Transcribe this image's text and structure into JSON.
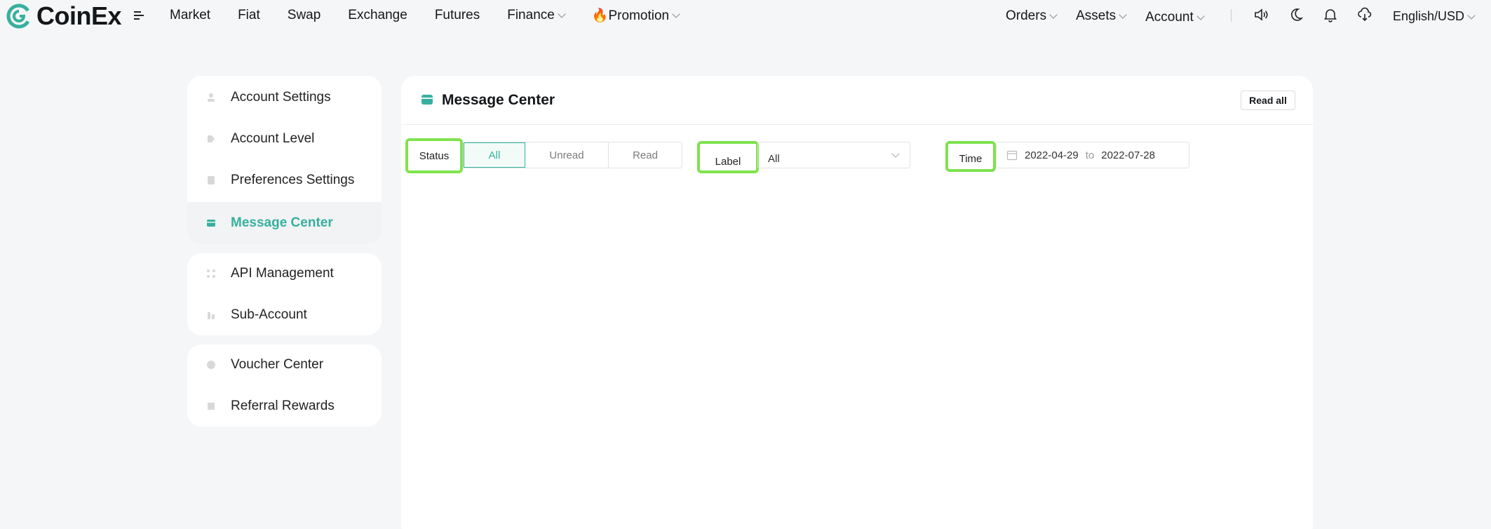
{
  "brand": {
    "name": "CoinEx",
    "accent": "#36b09e",
    "highlight": "#7ee34d"
  },
  "nav": {
    "left": [
      {
        "label": "Market",
        "dropdown": false
      },
      {
        "label": "Fiat",
        "dropdown": false
      },
      {
        "label": "Swap",
        "dropdown": false
      },
      {
        "label": "Exchange",
        "dropdown": false
      },
      {
        "label": "Futures",
        "dropdown": false
      },
      {
        "label": "Finance",
        "dropdown": true
      },
      {
        "label": "🔥Promotion",
        "dropdown": true
      }
    ],
    "right": [
      {
        "label": "Orders",
        "dropdown": true
      },
      {
        "label": "Assets",
        "dropdown": true
      },
      {
        "label": "Account",
        "dropdown": true
      }
    ],
    "language": "English/USD",
    "icons": [
      "sound-icon",
      "moon-icon",
      "bell-icon",
      "download-icon"
    ]
  },
  "sidebar": {
    "group1": [
      {
        "label": "Account Settings",
        "icon": "user-icon"
      },
      {
        "label": "Account Level",
        "icon": "level-icon"
      },
      {
        "label": "Preferences Settings",
        "icon": "preferences-icon"
      },
      {
        "label": "Message Center",
        "icon": "message-icon",
        "active": true
      }
    ],
    "group2": [
      {
        "label": "API Management",
        "icon": "api-icon"
      },
      {
        "label": "Sub-Account",
        "icon": "sub-account-icon"
      }
    ],
    "group3": [
      {
        "label": "Voucher Center",
        "icon": "voucher-icon"
      },
      {
        "label": "Referral Rewards",
        "icon": "referral-icon"
      }
    ]
  },
  "main": {
    "title": "Message Center",
    "read_all": "Read all",
    "filters": {
      "status_label": "Status",
      "status_options": [
        "All",
        "Unread",
        "Read"
      ],
      "status_selected": "All",
      "label_label": "Label",
      "label_value": "All",
      "time_label": "Time",
      "date_from": "2022-04-29",
      "date_to_word": "to",
      "date_to": "2022-07-28"
    }
  }
}
